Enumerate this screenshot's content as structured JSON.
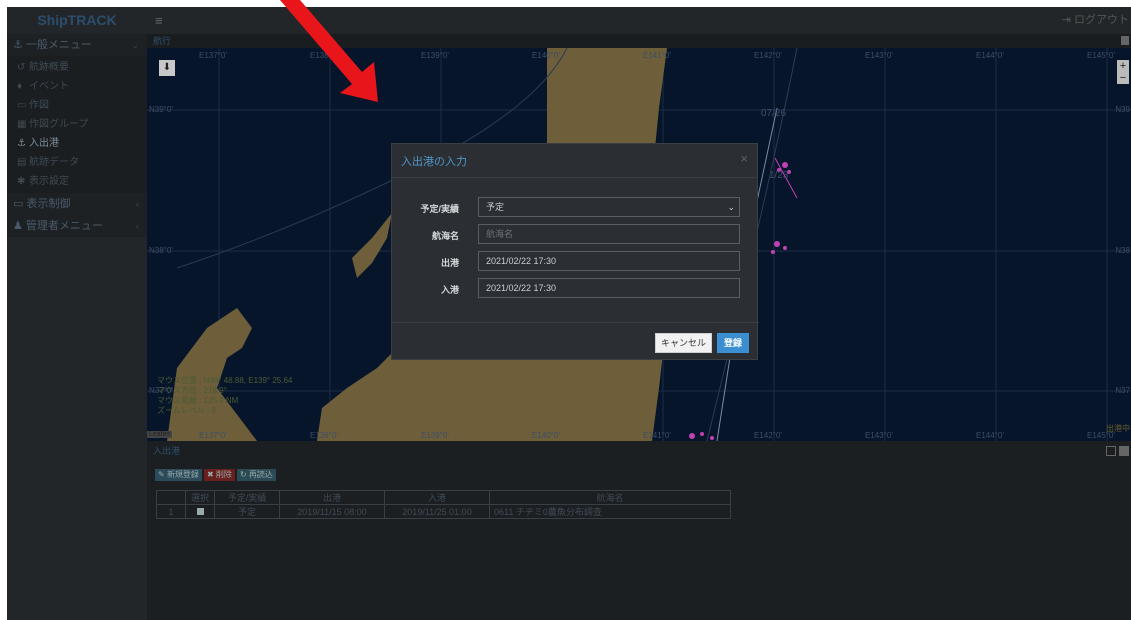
{
  "brand": "ShipTRACK",
  "header": {
    "menu_icon": "≡",
    "logout_label": "ログアウト"
  },
  "sidebar": {
    "general_menu": "一般メニュー",
    "items": [
      {
        "label": "航跡概要",
        "icon": "history-icon"
      },
      {
        "label": "イベント",
        "icon": "pin-icon"
      },
      {
        "label": "作図",
        "icon": "drawing-icon"
      },
      {
        "label": "作図グループ",
        "icon": "group-icon"
      },
      {
        "label": "入出港",
        "icon": "anchor-icon"
      },
      {
        "label": "航跡データ",
        "icon": "database-icon"
      },
      {
        "label": "表示設定",
        "icon": "gear-icon"
      }
    ],
    "display_control": "表示制御",
    "admin_menu": "管理者メニュー"
  },
  "map_panel": {
    "title": "航行",
    "lon_labels_top": [
      "E137°0'",
      "E138°0'",
      "E139°0'",
      "E140°0'",
      "E141°0'",
      "E142°0'",
      "E143°0'",
      "E144°0'",
      "E145°0'"
    ],
    "lon_labels_bottom": [
      "E137°0'",
      "E138°0'",
      "E139°0'",
      "E140°0'",
      "E141°0'",
      "E142°0'",
      "E143°0'",
      "E144°0'",
      "E145°0'"
    ],
    "lat_labels_left": [
      "N39°0'",
      "N38°0'",
      "N37°0'"
    ],
    "lat_labels_right": [
      "N39",
      "N38",
      "N37"
    ],
    "date_labels": [
      "07/26",
      "1/23"
    ],
    "mouse_info": [
      "マウス位置 : N38° 48.88, E139° 25.64",
      "マウス方位 : 218.9°",
      "マウス距離 : 125.8 NM",
      "ズームレベル : 8"
    ],
    "leaflet_label": "Leaflet",
    "port_label": "出港中"
  },
  "lower_panel": {
    "title": "入出港",
    "buttons": {
      "new": "新規登録",
      "delete": "削除",
      "reload": "再読込"
    },
    "columns": [
      "",
      "選択",
      "予定/実績",
      "出港",
      "入港",
      "航海名"
    ],
    "rows": [
      {
        "no": "1",
        "type": "予定",
        "departure": "2019/11/15 08:00",
        "arrival": "2019/11/25 01:00",
        "voyage": "0611 チヂミ0農魚分布調査"
      }
    ]
  },
  "modal": {
    "title": "入出港の入力",
    "close": "×",
    "fields": {
      "type_label": "予定/実績",
      "type_value": "予定",
      "voyage_label": "航海名",
      "voyage_placeholder": "航海名",
      "departure_label": "出港",
      "departure_value": "2021/02/22 17:30",
      "arrival_label": "入港",
      "arrival_value": "2021/02/22 17:30"
    },
    "cancel_label": "キャンセル",
    "submit_label": "登録"
  },
  "colors": {
    "annotation_arrow": "#e8161b",
    "submit": "#3b8ed0",
    "land": "#6e5f3a",
    "sea": "#07152b"
  }
}
